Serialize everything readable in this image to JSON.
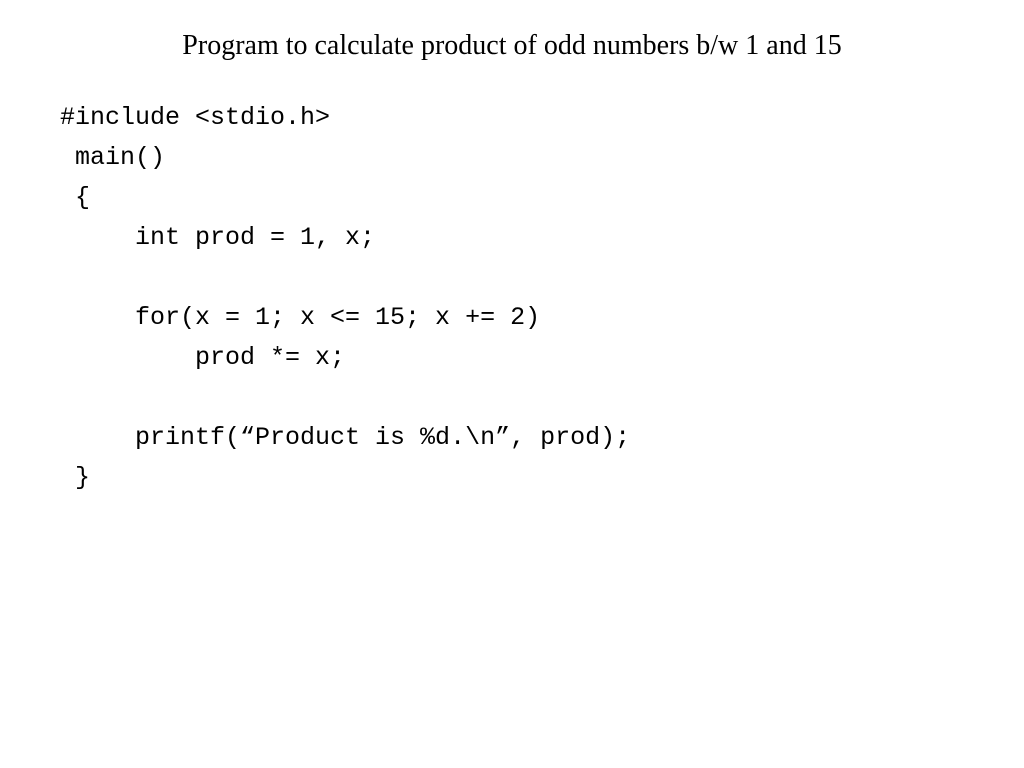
{
  "title": "Program to calculate product of odd numbers b/w 1 and 15",
  "code": {
    "line1": "#include <stdio.h>",
    "line2": " main()",
    "line3": " {",
    "line4": "     int prod = 1, x;",
    "line5": "",
    "line6": "     for(x = 1; x <= 15; x += 2)",
    "line7": "         prod *= x;",
    "line8": "",
    "line9": "     printf(“Product is %d.\\n”, prod);",
    "line10": " }"
  }
}
